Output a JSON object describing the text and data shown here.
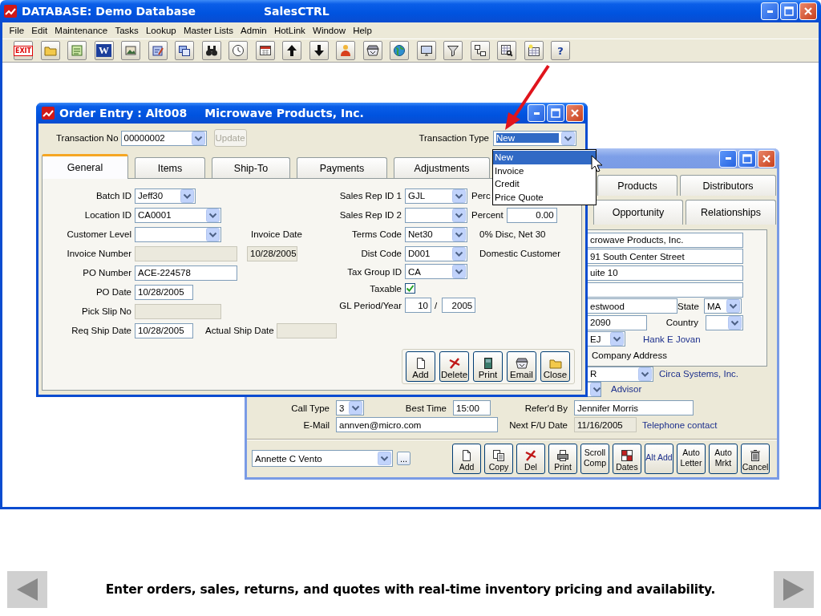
{
  "app": {
    "title": "DATABASE: Demo Database",
    "product": "SalesCTRL",
    "menu": [
      "File",
      "Edit",
      "Maintenance",
      "Tasks",
      "Lookup",
      "Master Lists",
      "Admin",
      "HotLink",
      "Window",
      "Help"
    ],
    "toolbar": [
      {
        "kind": "exit",
        "label": "EXIT"
      },
      {
        "kind": "folder"
      },
      {
        "kind": "notepad"
      },
      {
        "kind": "word",
        "label": "W"
      },
      {
        "kind": "image"
      },
      {
        "kind": "pad"
      },
      {
        "kind": "windows"
      },
      {
        "kind": "binoculars"
      },
      {
        "kind": "clock"
      },
      {
        "kind": "calendar"
      },
      {
        "kind": "up"
      },
      {
        "kind": "down"
      },
      {
        "kind": "person"
      },
      {
        "kind": "tray"
      },
      {
        "kind": "globe"
      },
      {
        "kind": "monitor"
      },
      {
        "kind": "filter"
      },
      {
        "kind": "network"
      },
      {
        "kind": "table_search"
      },
      {
        "kind": "table"
      },
      {
        "kind": "help",
        "label": "?"
      }
    ]
  },
  "order_entry": {
    "title": "Order Entry : Alt008",
    "subtitle": "Microwave Products, Inc.",
    "transaction_no": {
      "label": "Transaction No",
      "value": "00000002"
    },
    "update_button": {
      "label": "Update",
      "disabled": true
    },
    "transaction_type": {
      "label": "Transaction Type",
      "value": "New"
    },
    "tabs": [
      {
        "label": "General",
        "selected": true
      },
      {
        "label": "Items",
        "selected": false
      },
      {
        "label": "Ship-To",
        "selected": false
      },
      {
        "label": "Payments",
        "selected": false
      },
      {
        "label": "Adjustments",
        "selected": false
      }
    ],
    "left_rows": [
      {
        "label": "Batch ID",
        "items": [
          {
            "kind": "select",
            "value": "Jeff30",
            "disabled": false
          }
        ]
      },
      {
        "label": "Location ID",
        "items": [
          {
            "kind": "select",
            "value": "CA0001",
            "disabled": false
          }
        ]
      },
      {
        "label": "Customer Level",
        "items": [
          {
            "kind": "select",
            "disabled": false
          },
          {
            "kind": "note",
            "value": "Invoice Date"
          }
        ]
      },
      {
        "label": "Invoice Number",
        "items": [
          {
            "kind": "text",
            "disabled": true
          },
          {
            "kind": "text",
            "value": "10/28/2005",
            "disabled": true
          }
        ]
      },
      {
        "label": "PO Number",
        "items": [
          {
            "kind": "text",
            "value": "ACE-224578",
            "disabled": false
          }
        ]
      },
      {
        "label": "PO Date",
        "items": [
          {
            "kind": "text",
            "value": "10/28/2005",
            "disabled": false
          }
        ]
      },
      {
        "label": "Pick Slip No",
        "items": [
          {
            "kind": "text",
            "disabled": true
          }
        ]
      },
      {
        "label": "Req Ship Date",
        "items": [
          {
            "kind": "text",
            "value": "10/28/2005",
            "disabled": false
          },
          {
            "kind": "note",
            "value": "Actual Ship Date"
          },
          {
            "kind": "text",
            "disabled": true
          }
        ]
      }
    ],
    "right_rows": [
      {
        "label": "Sales Rep ID 1",
        "items": [
          {
            "kind": "select",
            "value": "GJL",
            "disabled": false
          },
          {
            "kind": "note",
            "value": "Perc"
          }
        ]
      },
      {
        "label": "Sales Rep ID 2",
        "items": [
          {
            "kind": "select",
            "disabled": false
          },
          {
            "kind": "note",
            "value": "Percent"
          },
          {
            "kind": "text",
            "value": "0.00",
            "disabled": false
          }
        ]
      },
      {
        "label": "Terms Code",
        "items": [
          {
            "kind": "select",
            "value": "Net30",
            "disabled": false
          },
          {
            "kind": "note",
            "value": "0% Disc, Net 30"
          }
        ]
      },
      {
        "label": "Dist Code",
        "items": [
          {
            "kind": "select",
            "value": "D001",
            "disabled": false
          },
          {
            "kind": "note",
            "value": "Domestic Customer"
          }
        ]
      },
      {
        "label": "Tax Group ID",
        "items": [
          {
            "kind": "select",
            "value": "CA",
            "disabled": false
          }
        ]
      },
      {
        "label": "Taxable",
        "items": [
          {
            "kind": "checkbox",
            "checked": true
          }
        ]
      },
      {
        "label": "GL Period/Year",
        "items": [
          {
            "kind": "text",
            "value": "10",
            "disabled": false
          },
          {
            "kind": "note",
            "value": "/"
          },
          {
            "kind": "text",
            "value": "2005",
            "disabled": false
          }
        ]
      }
    ],
    "buttons": [
      {
        "label": "Add",
        "kind": "add"
      },
      {
        "label": "Delete",
        "kind": "delete"
      },
      {
        "label": "Print",
        "kind": "book"
      },
      {
        "label": "Email",
        "kind": "tray"
      },
      {
        "label": "Close",
        "kind": "folder"
      }
    ]
  },
  "transaction_type_list": [
    {
      "label": "New",
      "selected": true
    },
    {
      "label": "Invoice",
      "selected": false
    },
    {
      "label": "Credit",
      "selected": false
    },
    {
      "label": "Price Quote",
      "selected": false
    }
  ],
  "customer_window": {
    "tabs_row_1": [
      {
        "label": "Products",
        "selected": false
      },
      {
        "label": "Distributors",
        "selected": false
      }
    ],
    "tabs_row_2": [
      {
        "label": "Opportunity",
        "selected": false
      },
      {
        "label": "Relationships",
        "selected": false
      }
    ],
    "panel_rows": [
      {
        "items": [
          {
            "kind": "text",
            "value": "crowave Products, Inc.",
            "disabled": false
          }
        ]
      },
      {
        "items": [
          {
            "kind": "text",
            "value": "91 South Center Street",
            "disabled": false
          }
        ]
      },
      {
        "items": [
          {
            "kind": "text",
            "value": "uite 10",
            "disabled": false
          }
        ]
      },
      {
        "items": [
          {
            "kind": "text",
            "disabled": false
          }
        ]
      },
      {
        "items": [
          {
            "kind": "text",
            "value": "estwood",
            "disabled": false
          },
          {
            "kind": "note",
            "value": "State"
          },
          {
            "kind": "select",
            "value": "MA",
            "disabled": false
          }
        ]
      },
      {
        "items": [
          {
            "kind": "text",
            "value": "2090",
            "disabled": false
          },
          {
            "kind": "note",
            "value": "Country"
          },
          {
            "kind": "select",
            "disabled": false
          }
        ]
      },
      {
        "items": [
          {
            "kind": "select",
            "value": "EJ",
            "disabled": false
          },
          {
            "kind": "info",
            "value": "Hank E Jovan"
          }
        ]
      },
      {
        "items": [
          {
            "kind": "note",
            "value": "Company Address"
          }
        ]
      }
    ],
    "side_rows": [
      {
        "items": [
          {
            "kind": "select",
            "value": "R",
            "disabled": false
          },
          {
            "kind": "info",
            "value": "Circa Systems, Inc."
          }
        ]
      },
      {
        "items": [
          {
            "kind": "select",
            "disabled": false
          },
          {
            "kind": "info",
            "value": "Advisor"
          }
        ]
      }
    ],
    "bottom_rows": [
      {
        "items": [
          {
            "kind": "note",
            "value": "Call Type"
          },
          {
            "kind": "select",
            "value": "3",
            "disabled": false
          },
          {
            "kind": "note",
            "value": "Best Time"
          },
          {
            "kind": "text",
            "value": "15:00",
            "disabled": false
          },
          {
            "kind": "note",
            "value": "Refer'd By"
          },
          {
            "kind": "text",
            "value": "Jennifer Morris",
            "disabled": false
          }
        ]
      },
      {
        "items": [
          {
            "kind": "note",
            "value": "E-Mail"
          },
          {
            "kind": "text",
            "value": "annven@micro.com",
            "disabled": false
          },
          {
            "kind": "note",
            "value": "Next F/U Date"
          },
          {
            "kind": "text",
            "value": "11/16/2005",
            "disabled": true
          },
          {
            "kind": "info",
            "value": "Telephone contact"
          }
        ]
      }
    ],
    "contact": {
      "value": "Annette C Vento",
      "browse_label": "..."
    },
    "buttons": [
      {
        "label": "Add",
        "kind": "add"
      },
      {
        "label": "Copy",
        "kind": "copy"
      },
      {
        "label": "Del",
        "kind": "delete"
      },
      {
        "label": "Print",
        "kind": "printer"
      },
      {
        "label": "Scroll Comp",
        "kind": "text"
      },
      {
        "label": "Dates",
        "kind": "dates"
      },
      {
        "label": "Alt Add",
        "kind": "text"
      },
      {
        "label": "Auto Letter",
        "kind": "text"
      },
      {
        "label": "Auto Mrkt",
        "kind": "text"
      },
      {
        "label": "Cancel",
        "kind": "trash"
      }
    ]
  },
  "caption": "Enter orders, sales, returns, and quotes with real-time inventory pricing and availability."
}
